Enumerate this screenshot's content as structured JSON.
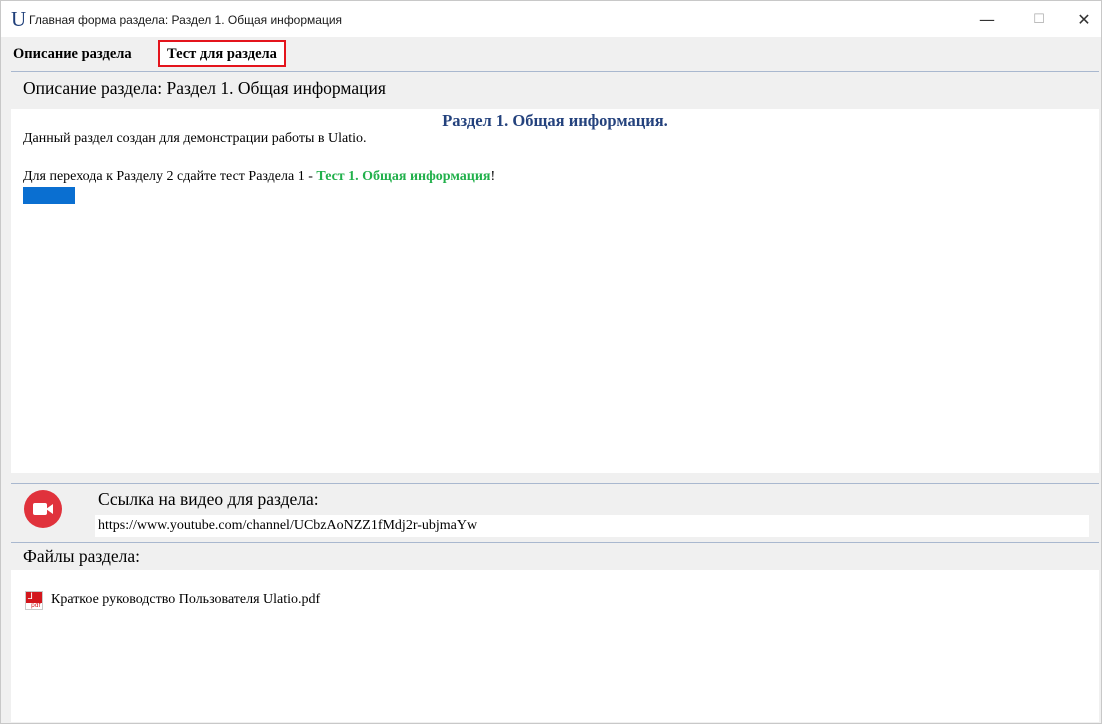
{
  "window": {
    "logo": "U",
    "title": "Главная форма раздела: Раздел 1. Общая информация",
    "minimize_glyph": "—",
    "maximize_glyph": "☐",
    "close_glyph": "✕"
  },
  "tabs": [
    {
      "label": "Описание раздела",
      "active": true
    },
    {
      "label": "Тест для раздела",
      "highlighted": true,
      "highlight_color": "#e4141c"
    }
  ],
  "description": {
    "header": "Описание раздела:  Раздел 1. Общая информация",
    "title": "Раздел 1. Общая информация.",
    "line1": "Данный раздел создан для демонстрации работы в Ulatio.",
    "line2_prefix": "Для перехода к Разделу 2 сдайте тест Раздела 1 - ",
    "line2_link": "Тест 1. Общая информация",
    "line2_suffix": "!",
    "title_color": "#24427d",
    "link_color": "#21b04b"
  },
  "video": {
    "icon": "video-camera-icon",
    "label": "Ссылка на видео для раздела:",
    "url": "https://www.youtube.com/channel/UCbzAoNZZ1fMdj2r-ubjmaYw"
  },
  "files": {
    "label": "Файлы раздела:",
    "items": [
      {
        "icon": "pdf-file-icon",
        "name": "Краткое руководство Пользователя Ulatio.pdf"
      }
    ]
  }
}
